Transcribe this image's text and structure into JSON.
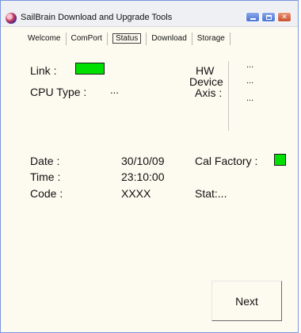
{
  "window": {
    "title": "SailBrain Download and Upgrade Tools",
    "buttons": {
      "minimize": "minimize",
      "maximize": "maximize",
      "close": "✕"
    }
  },
  "tabs": [
    {
      "label": "Welcome",
      "active": false
    },
    {
      "label": "ComPort",
      "active": false
    },
    {
      "label": "Status",
      "active": true
    },
    {
      "label": "Download",
      "active": false
    },
    {
      "label": "Storage",
      "active": false
    }
  ],
  "status": {
    "link_label": "Link :",
    "link_color": "#00e000",
    "cpu_type_label": "CPU Type :",
    "cpu_type_value": "...",
    "hw_label": "HW",
    "device_label": "Device",
    "axis_label": "Axis :",
    "hw_value": "...",
    "device_value": "...",
    "axis_value": "...",
    "date_label": "Date :",
    "date_value": "30/10/09",
    "time_label": "Time :",
    "time_value": "23:10:00",
    "code_label": "Code :",
    "code_value": "XXXX",
    "cal_factory_label": "Cal Factory :",
    "cal_factory_color": "#00e000",
    "stat_label": "Stat:..."
  },
  "actions": {
    "next_label": "Next"
  }
}
